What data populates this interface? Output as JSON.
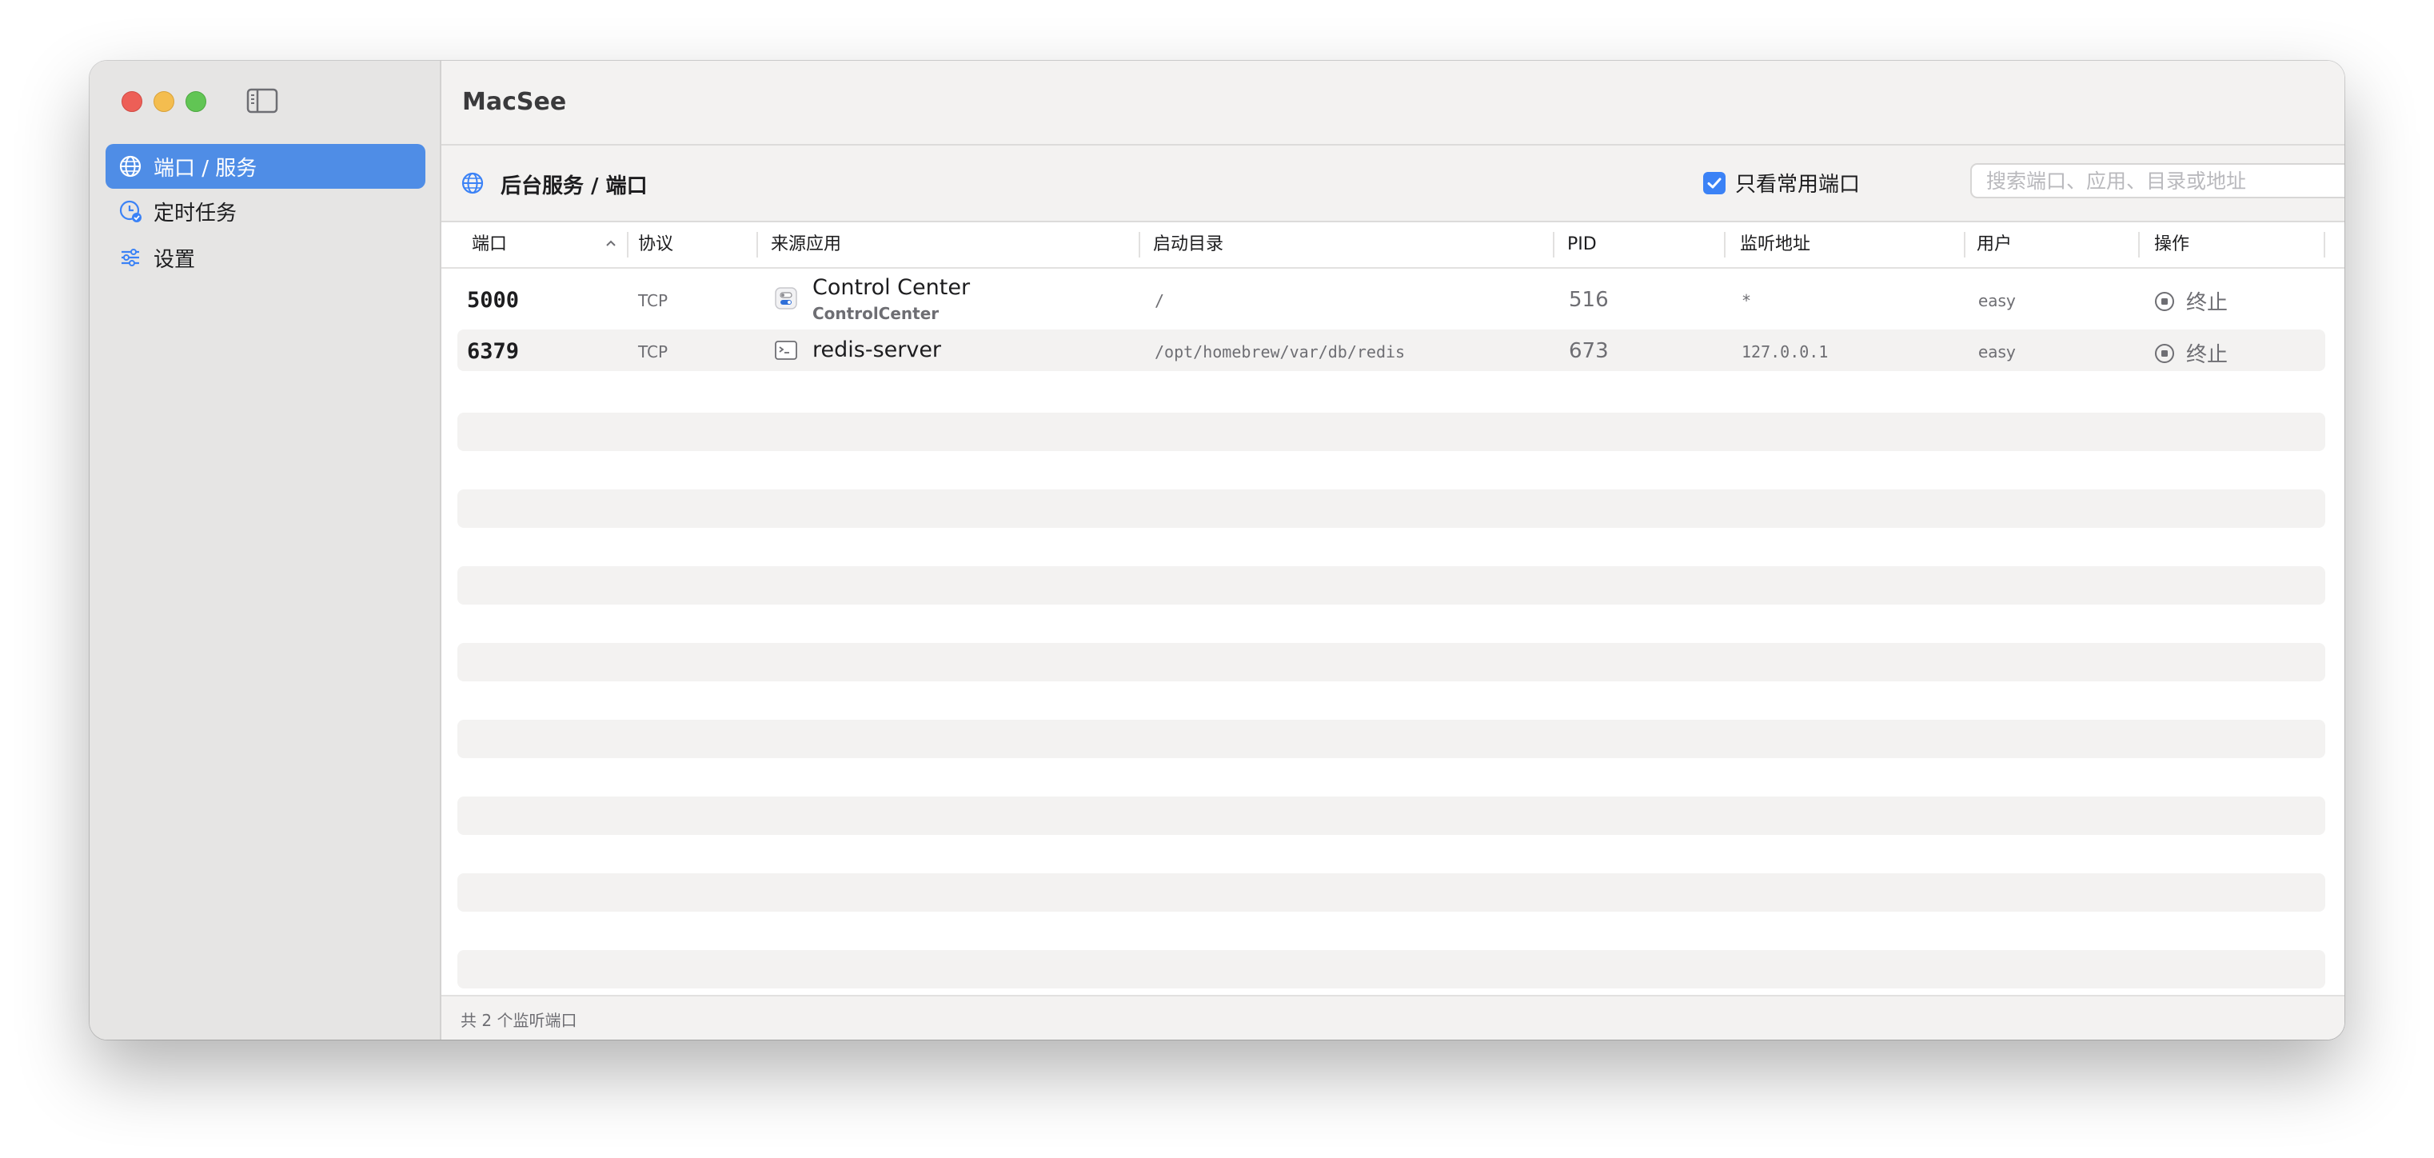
{
  "app": {
    "title": "MacSee"
  },
  "sidebar": {
    "items": [
      {
        "label": "端口 / 服务",
        "icon": "globe-icon",
        "active": true
      },
      {
        "label": "定时任务",
        "icon": "clock-badge-icon",
        "active": false
      },
      {
        "label": "设置",
        "icon": "sliders-icon",
        "active": false
      }
    ]
  },
  "toolbar": {
    "title": "后台服务 / 端口",
    "filter_label": "只看常用端口",
    "filter_checked": true,
    "search_placeholder": "搜索端口、应用、目录或地址"
  },
  "table": {
    "columns": [
      "端口",
      "协议",
      "来源应用",
      "启动目录",
      "PID",
      "监听地址",
      "用户",
      "操作"
    ],
    "sort_column": "端口",
    "sort_direction": "ascending",
    "rows": [
      {
        "port": "5000",
        "protocol": "TCP",
        "app_name": "Control Center",
        "app_process": "ControlCenter",
        "app_icon": "control-center-icon",
        "directory": "/",
        "pid": "516",
        "address": "*",
        "user": "easy",
        "action": "终止"
      },
      {
        "port": "6379",
        "protocol": "TCP",
        "app_name": "redis-server",
        "app_process": "",
        "app_icon": "terminal-icon",
        "directory": "/opt/homebrew/var/db/redis",
        "pid": "673",
        "address": "127.0.0.1",
        "user": "easy",
        "action": "终止"
      }
    ]
  },
  "status": {
    "text": "共 2 个监听端口"
  },
  "colors": {
    "accent": "#4f8de6",
    "checkbox": "#3b82f6",
    "close": "#ed5f57",
    "minimize": "#f4bd4f",
    "zoom": "#61c554"
  }
}
